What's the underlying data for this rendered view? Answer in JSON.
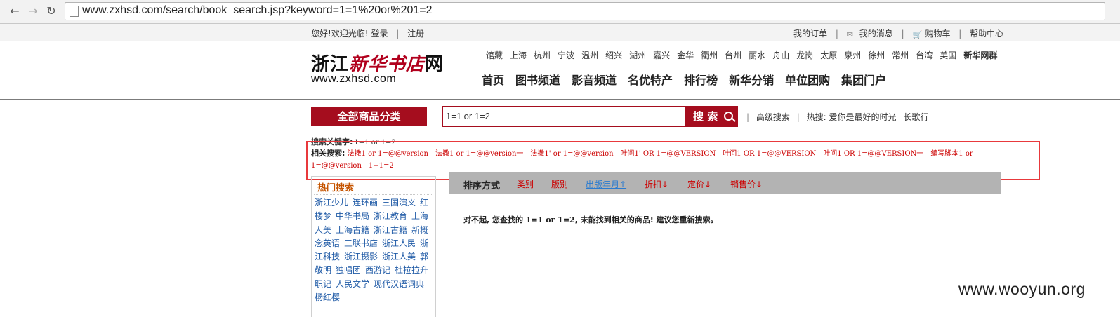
{
  "browser": {
    "url": "www.zxhsd.com/search/book_search.jsp?keyword=1=1%20or%201=2"
  },
  "topbar": {
    "greeting": "您好!欢迎光临!",
    "login": "登录",
    "register": "注册",
    "my_orders": "我的订单",
    "my_messages": "我的消息",
    "cart": "购物车",
    "help": "帮助中心"
  },
  "header": {
    "logo_cn_1": "浙江",
    "logo_cn_2": "新华书店",
    "logo_cn_3": "网",
    "logo_en": "www.zxhsd.com",
    "cities": [
      "馆藏",
      "上海",
      "杭州",
      "宁波",
      "温州",
      "绍兴",
      "湖州",
      "嘉兴",
      "金华",
      "衢州",
      "台州",
      "丽水",
      "舟山",
      "龙岗",
      "太原",
      "泉州",
      "徐州",
      "常州",
      "台湾",
      "美国"
    ],
    "cities_highlight": "新华网群",
    "nav": [
      "首页",
      "图书频道",
      "影音频道",
      "名优特产",
      "排行榜",
      "新华分销",
      "单位团购",
      "集团门户"
    ]
  },
  "search": {
    "all_categories": "全部商品分类",
    "query": "1=1 or 1=2",
    "button": "搜 索",
    "advanced": "高级搜索",
    "hot_label": "热搜:",
    "hot_terms": [
      "爱你是最好的时光",
      "长歌行"
    ]
  },
  "results": {
    "keyword_label": "搜索关键字:",
    "keyword_value": "1=1 or 1=2",
    "related_label": "相关搜索:",
    "related": [
      "法撒1 or 1=@@version",
      "法撒1 or 1=@@version一",
      "法撒1' or 1=@@version",
      "叶问1' OR 1=@@VERSION",
      "叶问1 OR 1=@@VERSION",
      "叶问1 OR 1=@@VERSION一",
      "编写脚本1 or 1=@@version",
      "1+1=2"
    ],
    "sort_title": "排序方式",
    "sort_options": [
      "类别",
      "版别",
      "出版年月↑",
      "折扣↓",
      "定价↓",
      "销售价↓"
    ],
    "no_result_prefix": "对不起, 您查找的",
    "no_result_query": "1=1 or 1=2",
    "no_result_suffix": ", 未能找到相关的商品! 建议您重新搜索。"
  },
  "sidebar": {
    "hot_title": "热门搜索",
    "hot_links": [
      "浙江少儿",
      "连环画",
      "三国演义",
      "红楼梦",
      "中华书局",
      "浙江教育",
      "上海人美",
      "上海古籍",
      "浙江古籍",
      "新概念英语",
      "三联书店",
      "浙江人民",
      "浙江科技",
      "浙江摄影",
      "浙江人美",
      "郭敬明",
      "独唱团",
      "西游记",
      "杜拉拉升职记",
      "人民文学",
      "现代汉语词典",
      "杨红樱"
    ]
  },
  "watermark": "www.wooyun.org"
}
